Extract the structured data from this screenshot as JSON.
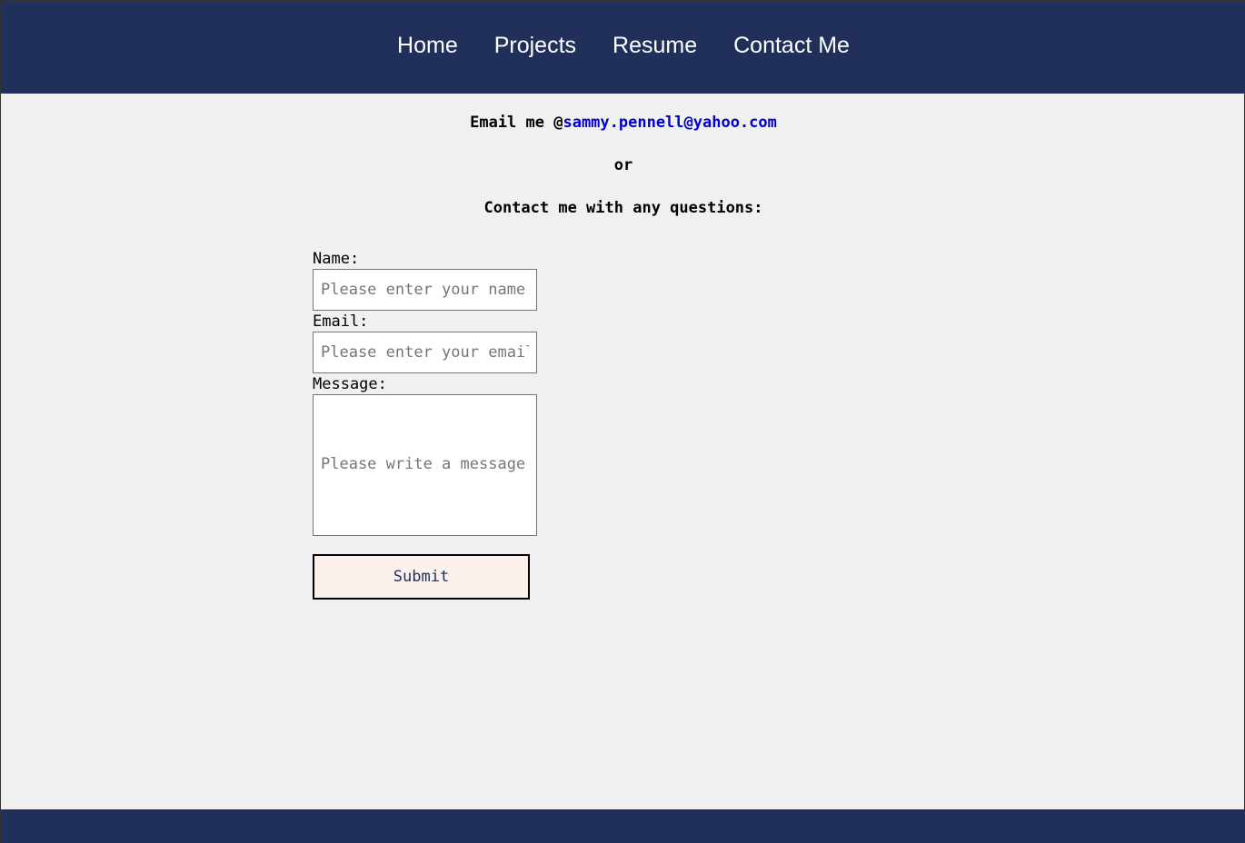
{
  "nav": {
    "items": [
      {
        "label": "Home"
      },
      {
        "label": "Projects"
      },
      {
        "label": "Resume"
      },
      {
        "label": "Contact Me"
      }
    ]
  },
  "contact": {
    "email_prefix": "Email me @",
    "email_address": "sammy.pennell@yahoo.com",
    "or_text": "or",
    "questions_text": "Contact me with any questions:"
  },
  "form": {
    "name_label": "Name:",
    "name_placeholder": "Please enter your name",
    "name_value": "",
    "email_label": "Email:",
    "email_placeholder": "Please enter your email",
    "email_value": "",
    "message_label": "Message:",
    "message_placeholder": "Please write a message",
    "message_value": "",
    "submit_label": "Submit"
  },
  "colors": {
    "header_bg": "#20305a",
    "page_bg": "#f0f0f0",
    "link": "#0000cc",
    "button_bg": "#fbf1ec"
  }
}
